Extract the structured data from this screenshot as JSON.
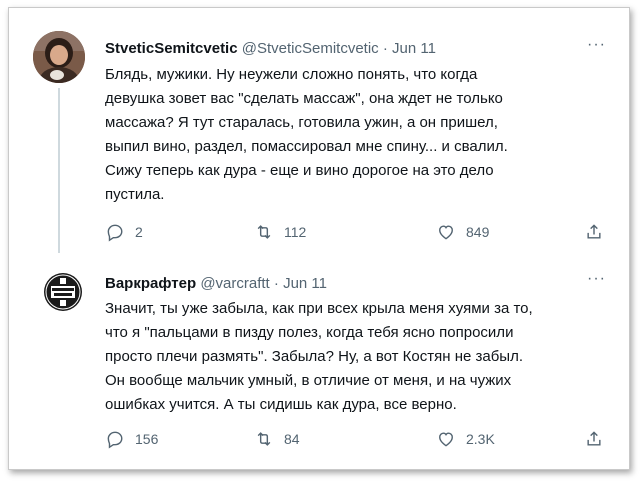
{
  "tweets": [
    {
      "name": "StveticSemitcvetic",
      "handle": "@StveticSemitcvetic",
      "separator": "·",
      "date": "Jun 11",
      "more": "···",
      "text": "Блядь, мужики. Ну неужели сложно понять, что когда\nдевушка зовет вас \"сделать массаж\", она ждет не только\nмассажа? Я тут старалась, готовила ужин, а он пришел,\nвыпил вино, раздел, помассировал мне спину... и свалил.\nСижу теперь как дура - еще и вино дорогое на это дело\nпустила.",
      "replies": "2",
      "retweets": "112",
      "likes": "849"
    },
    {
      "name": "Варкрафтер",
      "handle": "@varcraftt",
      "separator": "·",
      "date": "Jun 11",
      "more": "···",
      "avatar_text": "JOKE WAR GAME II",
      "text": "Значит, ты уже забыла, как при всех крыла меня хуями за то,\nчто я \"пальцами в пизду полез, когда тебя ясно попросили\nпросто плечи размять\". Забыла? Ну, а вот Костян не забыл.\nОн вообще мальчик умный, в отличие от меня, и на чужих\nошибках учится. А ты сидишь как дура, все верно.",
      "replies": "156",
      "retweets": "84",
      "likes": "2.3K"
    }
  ],
  "icons": {
    "reply": "reply-icon",
    "retweet": "retweet-icon",
    "like": "heart-icon",
    "share": "share-icon"
  }
}
